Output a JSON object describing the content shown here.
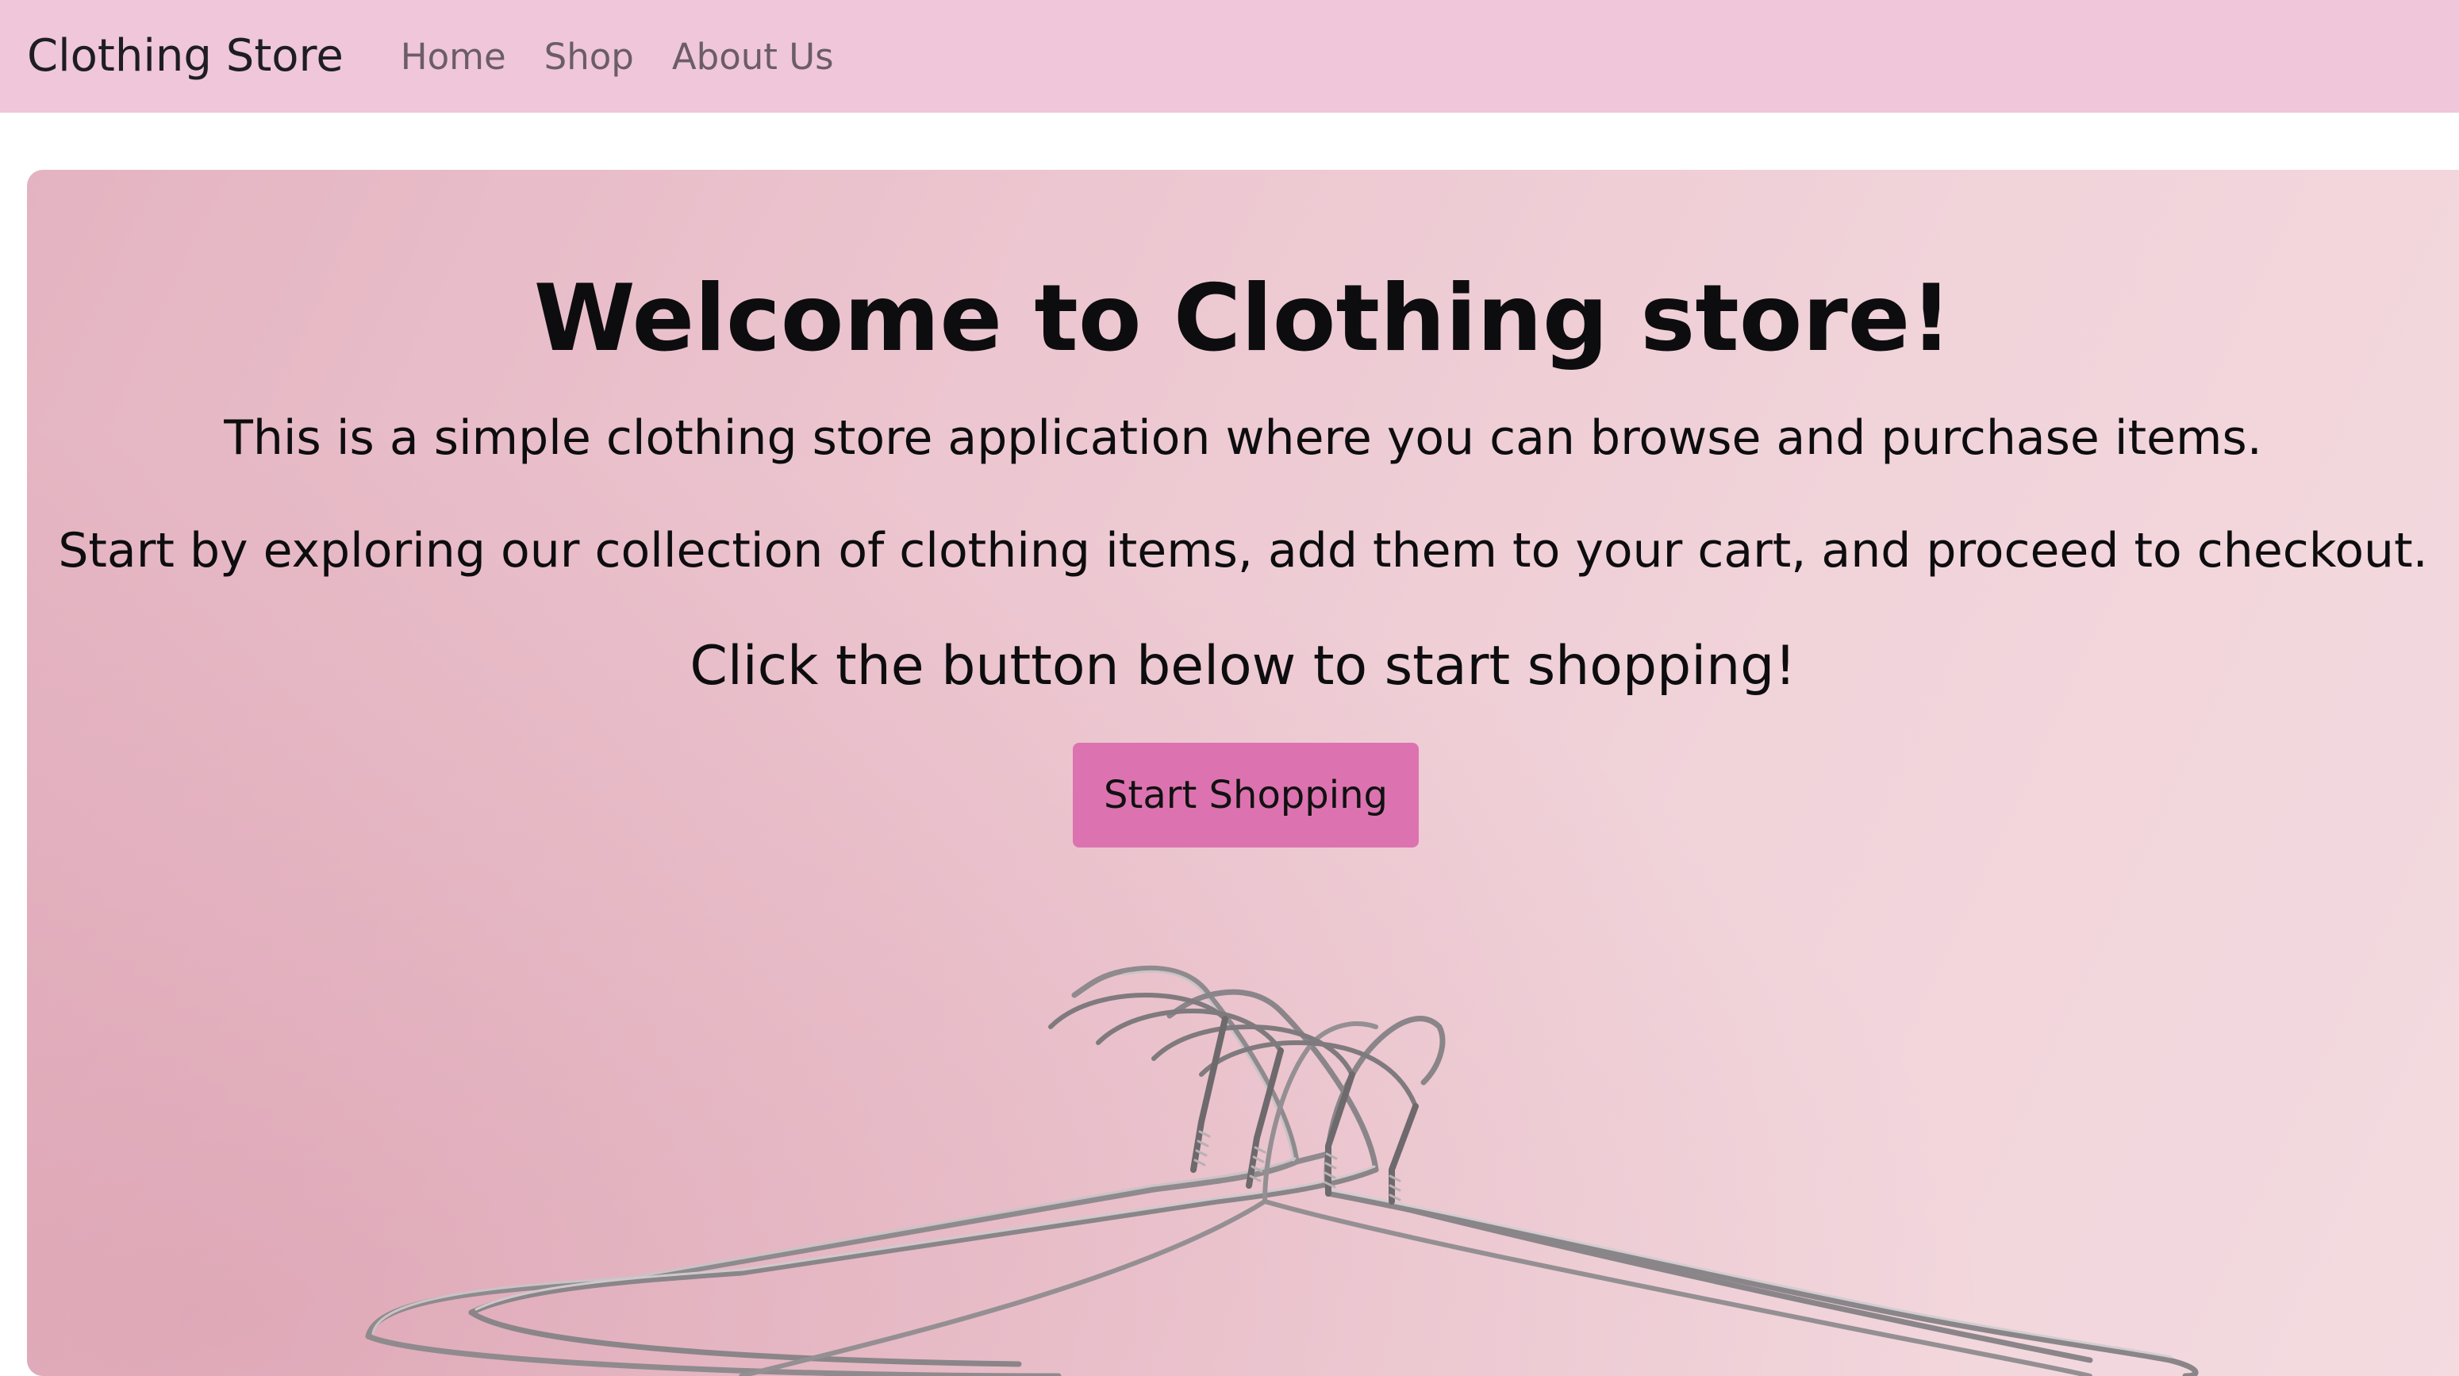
{
  "navbar": {
    "brand": "Clothing Store",
    "links": [
      "Home",
      "Shop",
      "About Us"
    ],
    "background": "#efc6da"
  },
  "hero": {
    "title": "Welcome to Clothing store!",
    "paragraphs": [
      "This is a simple clothing store application where you can browse and purchase items.",
      "Start by exploring our collection of clothing items, add them to your cart, and proceed to checkout.",
      "Click the button below to start shopping!"
    ],
    "button_label": "Start Shopping",
    "button_color": "#dc73b0",
    "image_icon": "clothes-hangers-image"
  }
}
